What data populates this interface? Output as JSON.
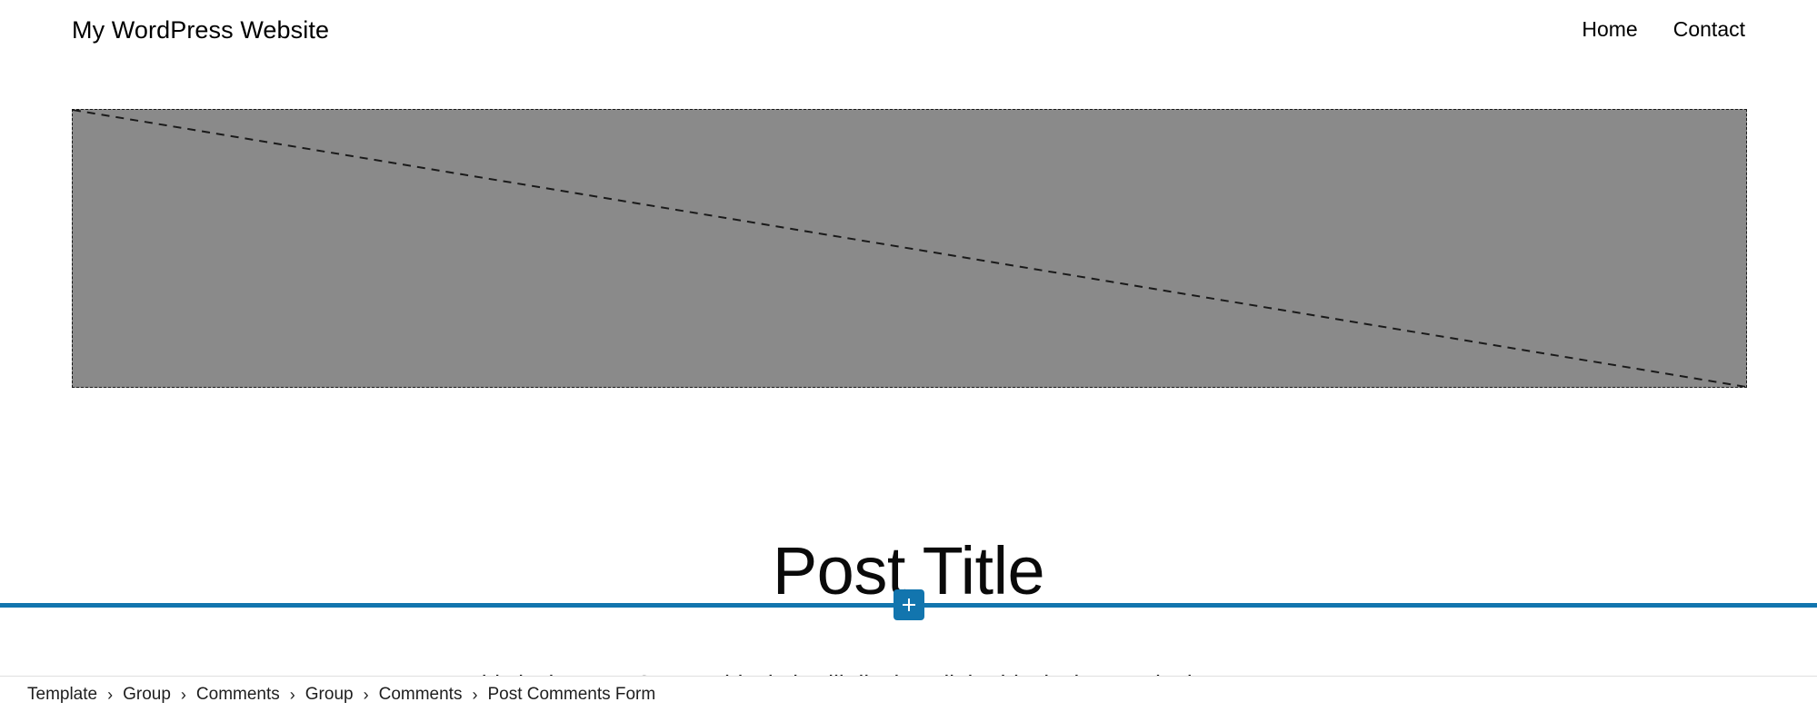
{
  "header": {
    "site_title": "My WordPress Website",
    "nav": [
      {
        "label": "Home",
        "name": "nav-link-home"
      },
      {
        "label": "Contact",
        "name": "nav-link-contact"
      }
    ]
  },
  "featured_image": {
    "icon": "image-placeholder-icon",
    "fill_color": "#8a8a8a",
    "border_color": "#1a1a1a"
  },
  "post": {
    "title": "Post Title",
    "content": "This is the Post Content block, it will display all the blocks in any single post or page."
  },
  "inserter": {
    "label": "+",
    "icon": "plus-icon",
    "accent_color": "#1275ae"
  },
  "breadcrumb": {
    "separator": "›",
    "items": [
      {
        "label": "Template"
      },
      {
        "label": "Group"
      },
      {
        "label": "Comments"
      },
      {
        "label": "Group"
      },
      {
        "label": "Comments"
      },
      {
        "label": "Post Comments Form"
      }
    ]
  }
}
